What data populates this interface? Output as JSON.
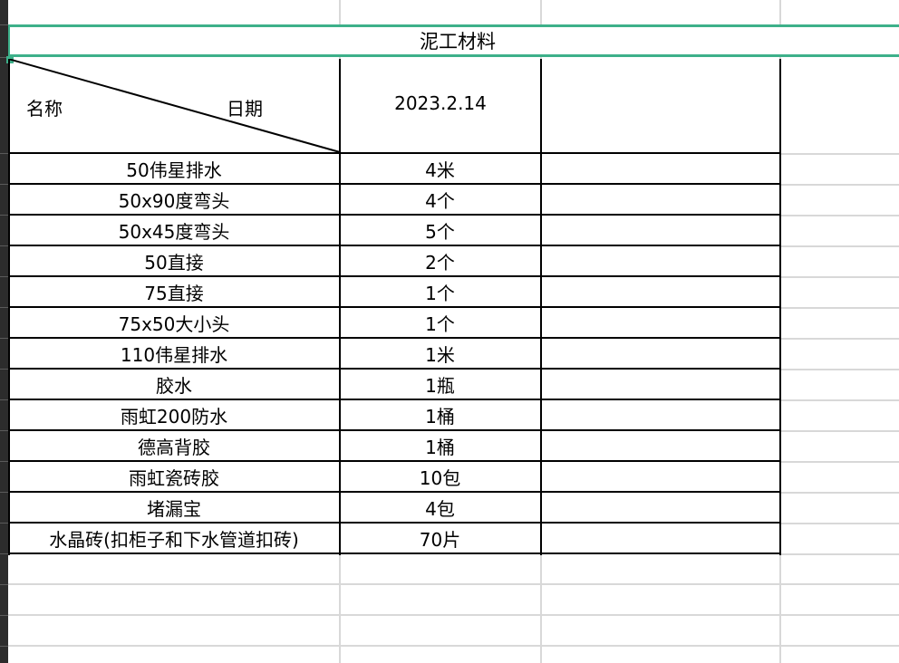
{
  "sheet": {
    "title": "泥工材料",
    "header": {
      "name_label": "名称",
      "date_label": "日期",
      "date_value": "2023.2.14"
    },
    "rows": [
      {
        "name": "50伟星排水",
        "qty": "4米"
      },
      {
        "name": "50x90度弯头",
        "qty": "4个"
      },
      {
        "name": "50x45度弯头",
        "qty": "5个"
      },
      {
        "name": "50直接",
        "qty": "2个"
      },
      {
        "name": "75直接",
        "qty": "1个"
      },
      {
        "name": "75x50大小头",
        "qty": "1个"
      },
      {
        "name": "110伟星排水",
        "qty": "1米"
      },
      {
        "name": "胶水",
        "qty": "1瓶"
      },
      {
        "name": "雨虹200防水",
        "qty": "1桶"
      },
      {
        "name": "德高背胶",
        "qty": "1桶"
      },
      {
        "name": "雨虹瓷砖胶",
        "qty": "10包"
      },
      {
        "name": "堵漏宝",
        "qty": "4包"
      },
      {
        "name": "水晶砖(扣柜子和下水管道扣砖)",
        "qty": "70片"
      }
    ]
  },
  "colors": {
    "selection": "#3db08a",
    "gridline": "#d8d8d8",
    "border": "#000000"
  }
}
